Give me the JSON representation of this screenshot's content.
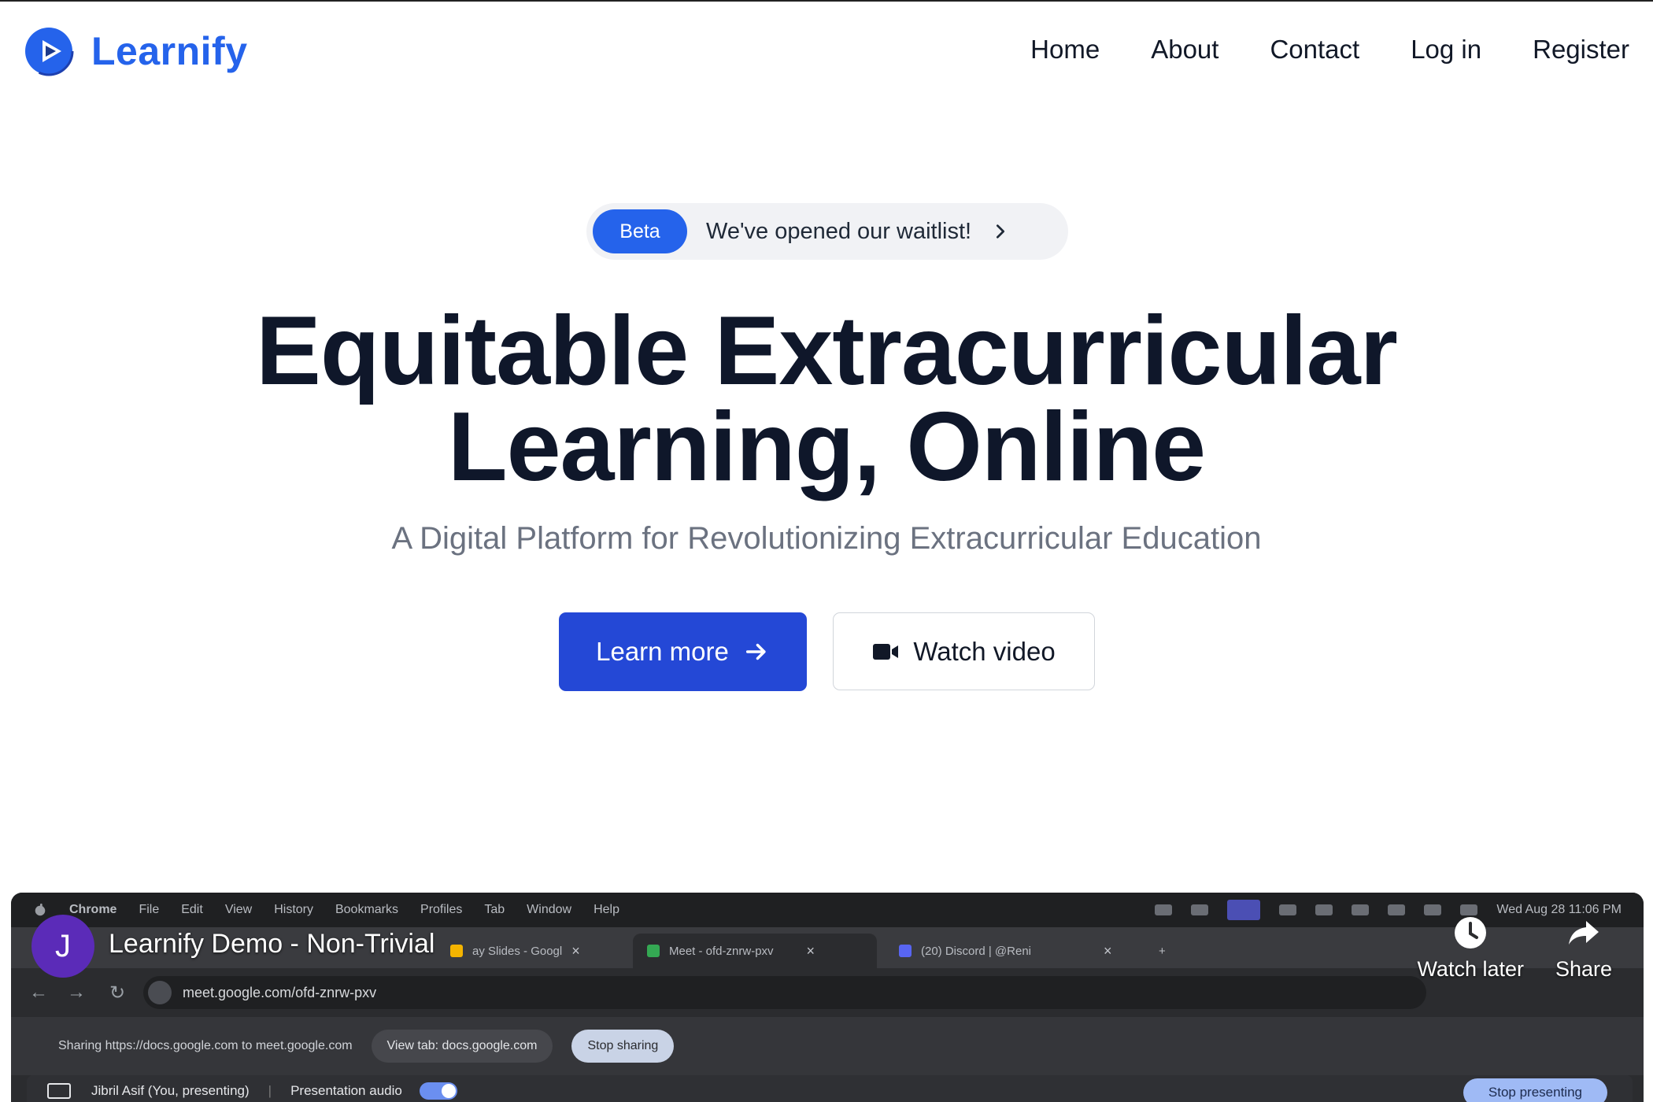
{
  "header": {
    "brand": "Learnify",
    "nav": [
      "Home",
      "About",
      "Contact",
      "Log in",
      "Register"
    ]
  },
  "badge": {
    "pill": "Beta",
    "text": "We've opened our waitlist!"
  },
  "hero": {
    "title_line1": "Equitable Extracurricular",
    "title_line2": "Learning, Online",
    "subtitle": "A Digital Platform for Revolutionizing Extracurricular Education",
    "primary_button": "Learn more",
    "secondary_button": "Watch video"
  },
  "video": {
    "channel_initial": "J",
    "title": "Learnify Demo - Non-Trivial",
    "watch_later": "Watch later",
    "share": "Share",
    "mac_menu": [
      "Chrome",
      "File",
      "Edit",
      "View",
      "History",
      "Bookmarks",
      "Profiles",
      "Tab",
      "Window",
      "Help"
    ],
    "clock": "Wed Aug 28  11:06 PM",
    "tabs": [
      {
        "label": "ay Slides - Googl",
        "fav_color": "#f4b400"
      },
      {
        "label": "Meet - ofd-znrw-pxv",
        "fav_color": "#34a853"
      },
      {
        "label": "(20) Discord | @Reni",
        "fav_color": "#5865f2"
      }
    ],
    "new_tab": "+",
    "url": "meet.google.com/ofd-znrw-pxv",
    "sharing_text": "Sharing https://docs.google.com to meet.google.com",
    "view_tab": "View tab: docs.google.com",
    "stop_sharing": "Stop sharing",
    "presenter": "Jibril Asif (You, presenting)",
    "presentation_audio": "Presentation audio",
    "stop_presenting": "Stop presenting"
  },
  "colors": {
    "brand": "#2563eb",
    "primary_button": "#2448d6",
    "heading": "#0f172a",
    "subtitle": "#6b7280"
  }
}
